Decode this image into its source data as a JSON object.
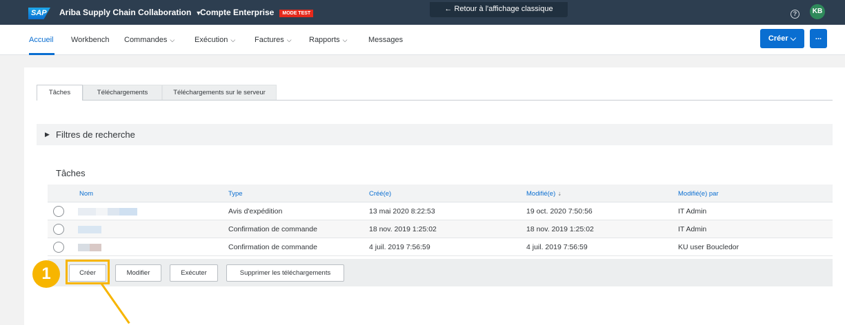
{
  "shell": {
    "logo": "SAP",
    "app_title": "Ariba Supply Chain Collaboration",
    "account": "Compte Enterprise",
    "mode_badge": "MODE TEST",
    "classic_link": "← Retour à l'affichage classique",
    "help_glyph": "?",
    "avatar_initials": "KB"
  },
  "nav": {
    "items": [
      {
        "label": "Accueil",
        "caret": ""
      },
      {
        "label": "Workbench",
        "caret": ""
      },
      {
        "label": "Commandes",
        "caret": "⌵"
      },
      {
        "label": "Exécution",
        "caret": "⌵"
      },
      {
        "label": "Factures",
        "caret": "⌵"
      },
      {
        "label": "Rapports",
        "caret": "⌵"
      },
      {
        "label": "Messages",
        "caret": ""
      }
    ],
    "create_label": "Créer ⌵",
    "more_label": "..."
  },
  "tabs": [
    {
      "label": "Tâches",
      "active": true
    },
    {
      "label": "Téléchargements",
      "active": false
    },
    {
      "label": "Téléchargements sur le serveur",
      "active": false
    }
  ],
  "filters": {
    "arrow": "▶",
    "label": "Filtres de recherche"
  },
  "tasks": {
    "title": "Tâches",
    "columns": [
      "Nom",
      "Type",
      "Créé(e)",
      "Modifié(e)",
      "Modifié(e) par"
    ],
    "sort_glyph": "⇣",
    "rows": [
      {
        "type": "Avis d'expédition",
        "created": "13 mai 2020 8:22:53",
        "modified": "19 oct. 2020 7:50:56",
        "modified_by": "IT Admin"
      },
      {
        "type": "Confirmation de commande",
        "created": "18 nov. 2019 1:25:02",
        "modified": "18 nov. 2019 1:25:02",
        "modified_by": "IT Admin"
      },
      {
        "type": "Confirmation de commande",
        "created": "4 juil. 2019 7:56:59",
        "modified": "4 juil. 2019 7:56:59",
        "modified_by": "KU user Boucledor"
      }
    ]
  },
  "actions": {
    "create": "Créer",
    "modify": "Modifier",
    "execute": "Exécuter",
    "delete_downloads": "Supprimer les téléchargements"
  },
  "annotation": {
    "step": "1",
    "color": "#f7b500"
  },
  "colors": {
    "shell": "#2d3e50",
    "accent": "#0a6ed1",
    "mode_badge": "#e62a1c",
    "avatar": "#2f8a5b"
  }
}
